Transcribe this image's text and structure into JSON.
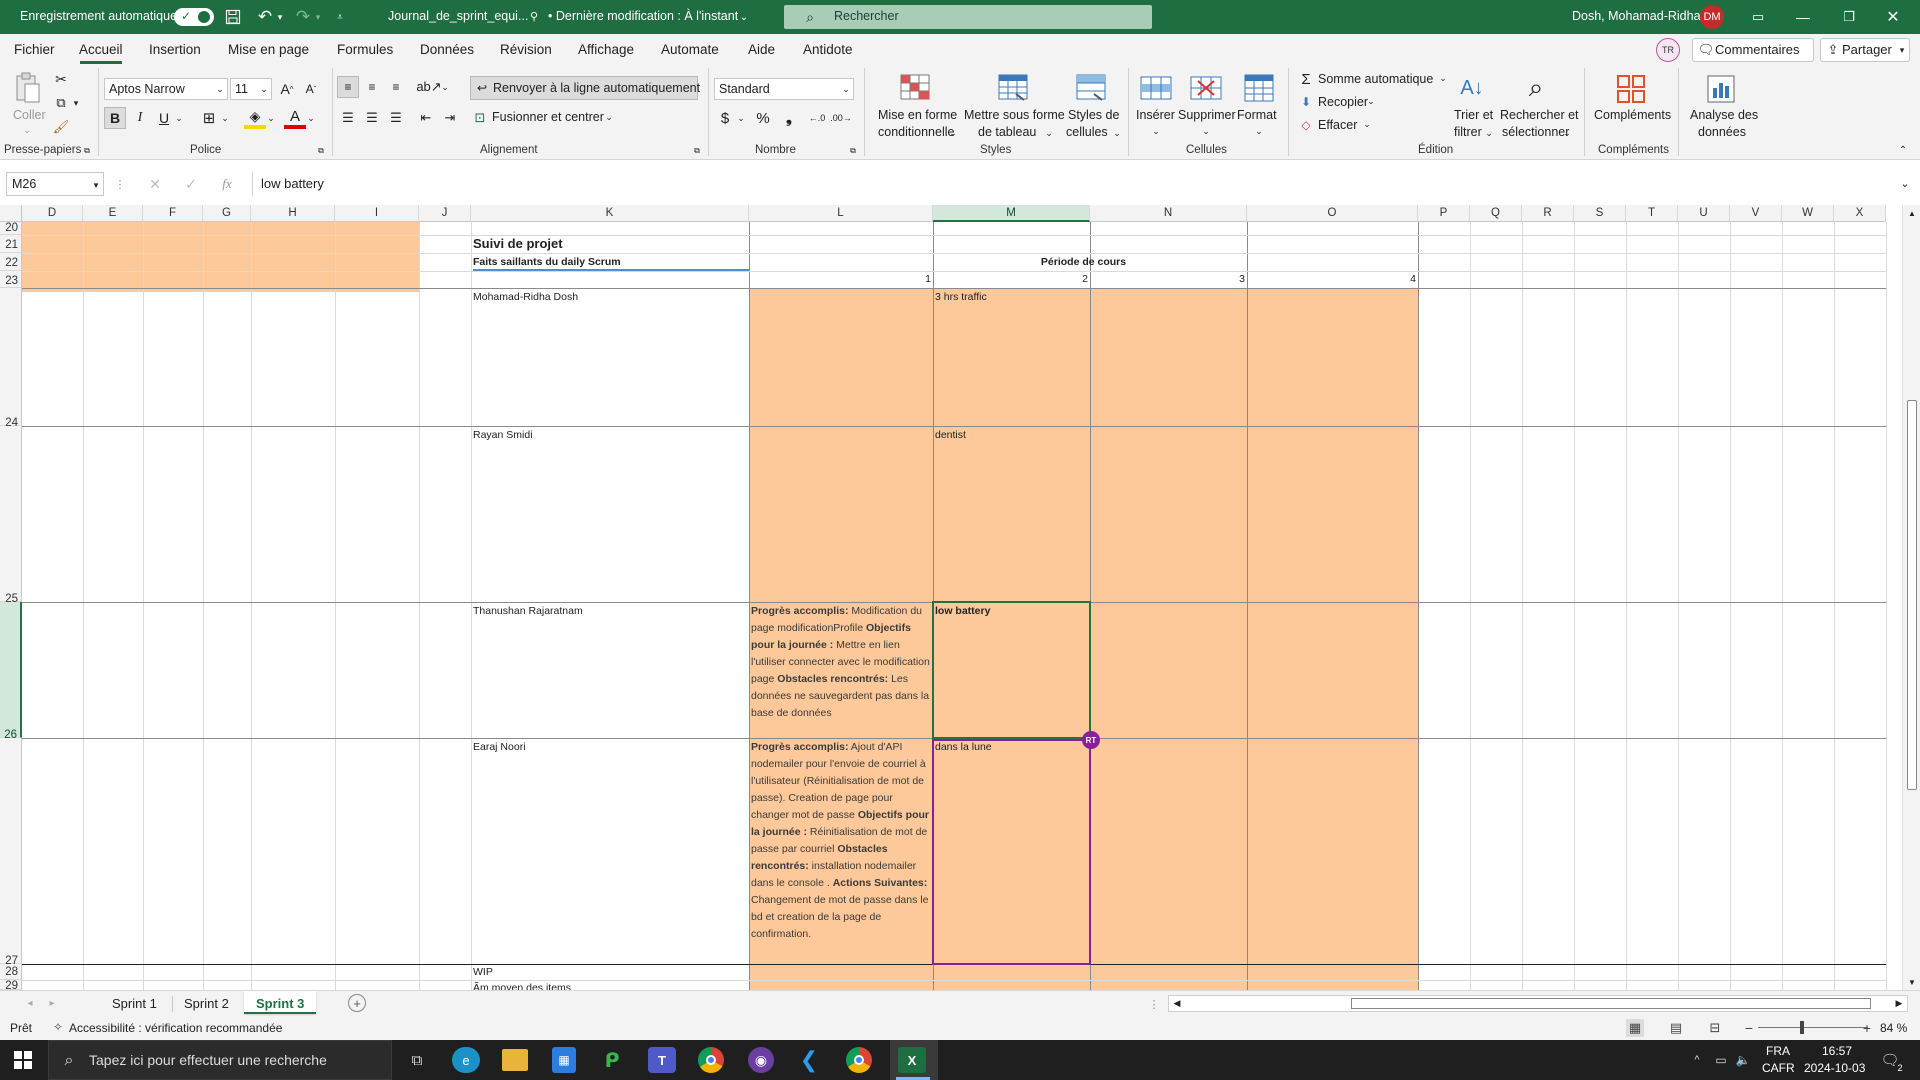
{
  "titlebar": {
    "autosave_label": "Enregistrement automatique",
    "filename": "Journal_de_sprint_equi...",
    "last_modified": "• Dernière modification : À l'instant",
    "search_placeholder": "Rechercher",
    "user_name": "Dosh, Mohamad-Ridha",
    "user_initials": "DM"
  },
  "menu": {
    "tabs": [
      "Fichier",
      "Accueil",
      "Insertion",
      "Mise en page",
      "Formules",
      "Données",
      "Révision",
      "Affichage",
      "Automate",
      "Aide",
      "Antidote"
    ],
    "active": "Accueil",
    "presence_initials": "TR",
    "comments_label": "Commentaires",
    "share_label": "Partager"
  },
  "ribbon": {
    "paste_label": "Coller",
    "font_name": "Aptos Narrow",
    "font_size": "11",
    "wrap_label": "Renvoyer à la ligne automatiquement",
    "merge_label": "Fusionner et centrer",
    "number_format": "Standard",
    "cond_format": [
      "Mise en forme",
      "conditionnelle"
    ],
    "table_format": [
      "Mettre sous forme",
      "de tableau"
    ],
    "cell_styles": [
      "Styles de",
      "cellules"
    ],
    "insert_label": "Insérer",
    "delete_label": "Supprimer",
    "format_label": "Format",
    "autosum_label": "Somme automatique",
    "fill_label": "Recopier",
    "clear_label": "Effacer",
    "sort_label": [
      "Trier et",
      "filtrer"
    ],
    "find_label": [
      "Rechercher et",
      "sélectionner"
    ],
    "addins_label": "Compléments",
    "analyze_label": [
      "Analyse des",
      "données"
    ],
    "groups": {
      "clipboard": "Presse-papiers",
      "font": "Police",
      "alignment": "Alignement",
      "number": "Nombre",
      "styles": "Styles",
      "cells": "Cellules",
      "editing": "Édition",
      "addins": "Compléments"
    }
  },
  "formula_bar": {
    "name_box": "M26",
    "content": "low battery"
  },
  "grid": {
    "columns": [
      "D",
      "E",
      "F",
      "G",
      "H",
      "I",
      "J",
      "K",
      "L",
      "M",
      "N",
      "O",
      "P",
      "Q",
      "R",
      "S",
      "T",
      "U",
      "V",
      "W",
      "X"
    ],
    "rows": [
      "20",
      "21",
      "22",
      "23",
      "24",
      "25",
      "26",
      "27",
      "28",
      "29"
    ],
    "title": "Suivi de projet",
    "subtitle": "Faits saillants du daily Scrum",
    "period_header": "Période de cours",
    "period_numbers": [
      "1",
      "2",
      "3",
      "4"
    ],
    "members": [
      {
        "name": "Mohamad-Ridha Dosh",
        "p1": "",
        "p2": "3 hrs traffic"
      },
      {
        "name": "Rayan Smidi",
        "p1": "",
        "p2": "dentist"
      },
      {
        "name": "Thanushan Rajaratnam",
        "p2": "low battery",
        "p1_parts": [
          {
            "b": true,
            "t": "Progrès accomplis:"
          },
          {
            "b": false,
            "t": " Modification du page modificationProfile "
          },
          {
            "b": true,
            "t": "Objectifs pour la journée :"
          },
          {
            "b": false,
            "t": "  Mettre en lien l'utiliser connecter avec le modification page  "
          },
          {
            "b": true,
            "t": "Obstacles rencontrés:"
          },
          {
            "b": false,
            "t": " Les données ne sauvegardent pas dans la base de données"
          }
        ]
      },
      {
        "name": "Earaj Noori",
        "p2": "dans la lune",
        "p1_parts": [
          {
            "b": true,
            "t": "Progrès accomplis:"
          },
          {
            "b": false,
            "t": " Ajout d'API nodemailer pour l'envoie de courriel à l'utilisateur (Réinitialisation de mot de passe). Creation de page pour changer mot de passe "
          },
          {
            "b": true,
            "t": "Objectifs pour la journée :"
          },
          {
            "b": false,
            "t": " Réinitialisation de mot de passe par courriel  "
          },
          {
            "b": true,
            "t": "Obstacles rencontrés:"
          },
          {
            "b": false,
            "t": " installation nodemailer dans le console .  "
          },
          {
            "b": true,
            "t": "Actions Suivantes:"
          },
          {
            "b": false,
            "t": " Changement de mot de passe dans le bd et creation de la page de confirmation."
          }
        ]
      }
    ],
    "wip_label": "WIP",
    "row29_text": "Ãm moyen des items",
    "cursor_badge": "RT"
  },
  "sheets": {
    "tabs": [
      "Sprint 1",
      "Sprint 2",
      "Sprint 3"
    ],
    "active": "Sprint 3"
  },
  "status": {
    "ready": "Prêt",
    "accessibility": "Accessibilité : vérification recommandée",
    "zoom": "84 %"
  },
  "taskbar": {
    "search_placeholder": "Tapez ici pour effectuer une recherche",
    "lang": "FRA",
    "layout": "CAFR",
    "time": "16:57",
    "date": "2024-10-03",
    "notif_count": "2"
  },
  "colors": {
    "excel_green": "#1e6e42",
    "peach": "#fdc99a",
    "selection": "#217346",
    "collab": "#8a1f9e"
  }
}
